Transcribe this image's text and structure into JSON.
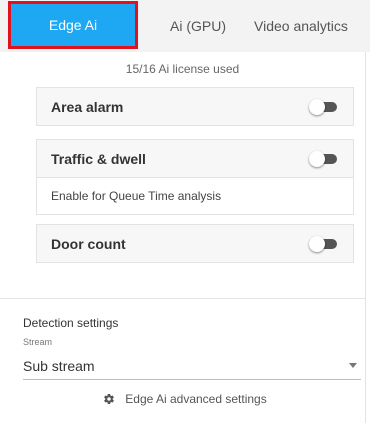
{
  "tabs": [
    {
      "label": "Edge Ai",
      "active": true
    },
    {
      "label": "Ai (GPU)",
      "active": false
    },
    {
      "label": "Video analytics",
      "active": false
    }
  ],
  "license_text": "15/16 Ai license used",
  "features": [
    {
      "label": "Area alarm",
      "enabled": false
    },
    {
      "label": "Traffic & dwell",
      "enabled": false,
      "description": "Enable for Queue Time analysis"
    },
    {
      "label": "Door count",
      "enabled": false
    }
  ],
  "detection": {
    "title": "Detection settings",
    "stream_label": "Stream",
    "stream_value": "Sub stream"
  },
  "advanced_settings_label": "Edge Ai advanced settings",
  "icons": {
    "advanced": "gear-icon",
    "dropdown": "caret-down-icon"
  },
  "colors": {
    "active_tab": "#1ea7f2",
    "highlight_border": "#e0121f",
    "toggle_track": "#555555"
  }
}
